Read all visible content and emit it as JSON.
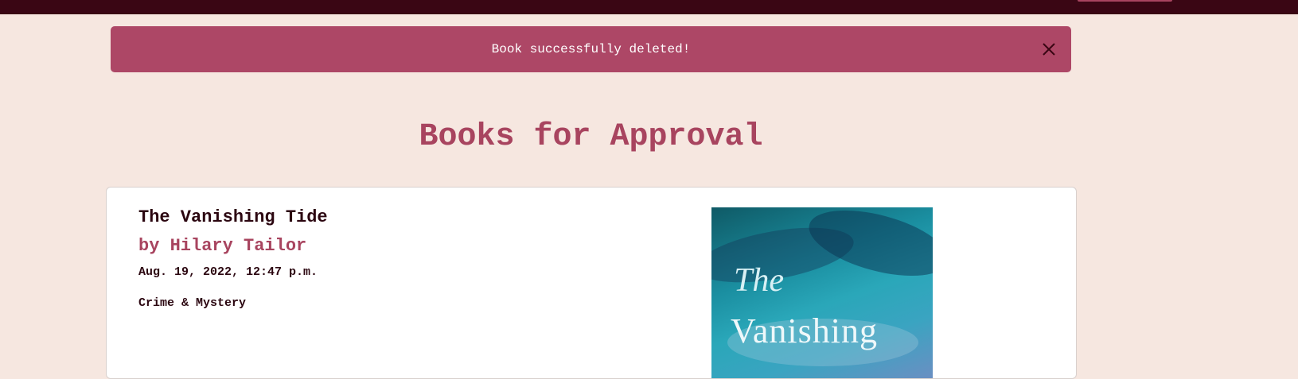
{
  "alert": {
    "message": "Book successfully deleted!",
    "close_icon": "close-icon"
  },
  "page": {
    "title": "Books for Approval"
  },
  "books": [
    {
      "title": "The Vanishing Tide",
      "author": "by Hilary Tailor",
      "date": "Aug. 19, 2022, 12:47 p.m.",
      "genre": "Crime & Mystery",
      "cover_text_line1": "The",
      "cover_text_line2": "Vanishing"
    }
  ],
  "colors": {
    "navbar": "#3a0614",
    "accent": "#a8445f",
    "alert": "#ad4766",
    "background": "#f6e7e0",
    "text_dark": "#2b0610"
  }
}
